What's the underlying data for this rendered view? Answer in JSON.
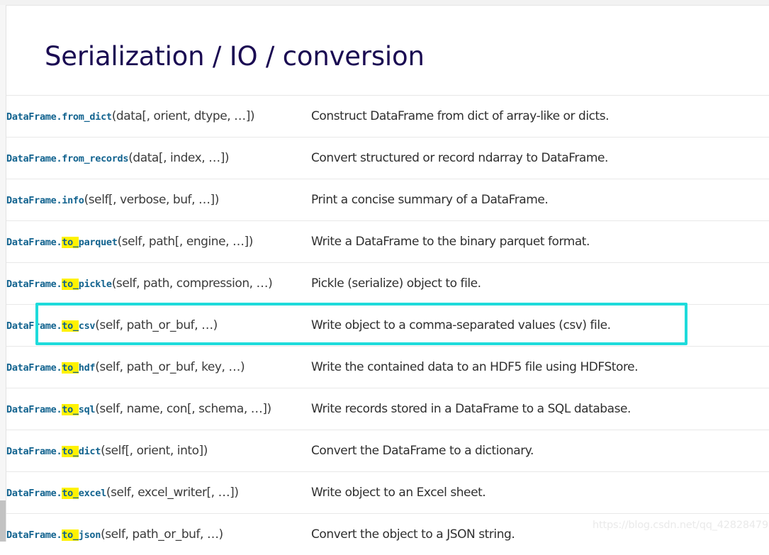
{
  "page": {
    "title": "Serialization / IO / conversion",
    "watermark": "https://blog.csdn.net/qq_42828479"
  },
  "colors": {
    "title": "#1a0a52",
    "code_blue": "#12638f",
    "highlight_yellow": "#fff200",
    "annotation_cyan": "#1edbdb",
    "row_divider": "#e8e8e8",
    "description_text": "#2f2f2f",
    "watermark": "#eaeaea",
    "background": "#ffffff"
  },
  "annotation": {
    "type": "rectangle-outline",
    "target_row_index": 5,
    "target_method": "DataFrame.to_csv",
    "color": "#1edbdb"
  },
  "table": {
    "rows": [
      {
        "prefix": "DataFrame.",
        "highlight": "",
        "name": "from_dict",
        "args": "(data[, orient, dtype, …])",
        "description": "Construct DataFrame from dict of array-like or dicts.",
        "selected": false
      },
      {
        "prefix": "DataFrame.",
        "highlight": "",
        "name": "from_records",
        "args": "(data[, index, …])",
        "description": "Convert structured or record ndarray to DataFrame.",
        "selected": false
      },
      {
        "prefix": "DataFrame.",
        "highlight": "",
        "name": "info",
        "args": "(self[, verbose, buf, …])",
        "description": "Print a concise summary of a DataFrame.",
        "selected": false
      },
      {
        "prefix": "DataFrame.",
        "highlight": "to_",
        "name": "parquet",
        "args": "(self, path[, engine, …])",
        "description": "Write a DataFrame to the binary parquet format.",
        "selected": false
      },
      {
        "prefix": "DataFrame.",
        "highlight": "to_",
        "name": "pickle",
        "args": "(self, path, compression, …)",
        "description": "Pickle (serialize) object to file.",
        "selected": false
      },
      {
        "prefix": "DataFrame.",
        "highlight": "to_",
        "name": "csv",
        "args": "(self, path_or_buf, …)",
        "description": "Write object to a comma-separated values (csv) file.",
        "selected": true
      },
      {
        "prefix": "DataFrame.",
        "highlight": "to_",
        "name": "hdf",
        "args": "(self, path_or_buf, key, …)",
        "description": "Write the contained data to an HDF5 file using HDFStore.",
        "selected": false
      },
      {
        "prefix": "DataFrame.",
        "highlight": "to_",
        "name": "sql",
        "args": "(self, name, con[, schema, …])",
        "description": "Write records stored in a DataFrame to a SQL database.",
        "selected": false
      },
      {
        "prefix": "DataFrame.",
        "highlight": "to_",
        "name": "dict",
        "args": "(self[, orient, into])",
        "description": "Convert the DataFrame to a dictionary.",
        "selected": false
      },
      {
        "prefix": "DataFrame.",
        "highlight": "to_",
        "name": "excel",
        "args": "(self, excel_writer[, …])",
        "description": "Write object to an Excel sheet.",
        "selected": false
      },
      {
        "prefix": "DataFrame.",
        "highlight": "to_",
        "name": "json",
        "args": "(self, path_or_buf, …)",
        "description": "Convert the object to a JSON string.",
        "selected": false
      }
    ]
  }
}
